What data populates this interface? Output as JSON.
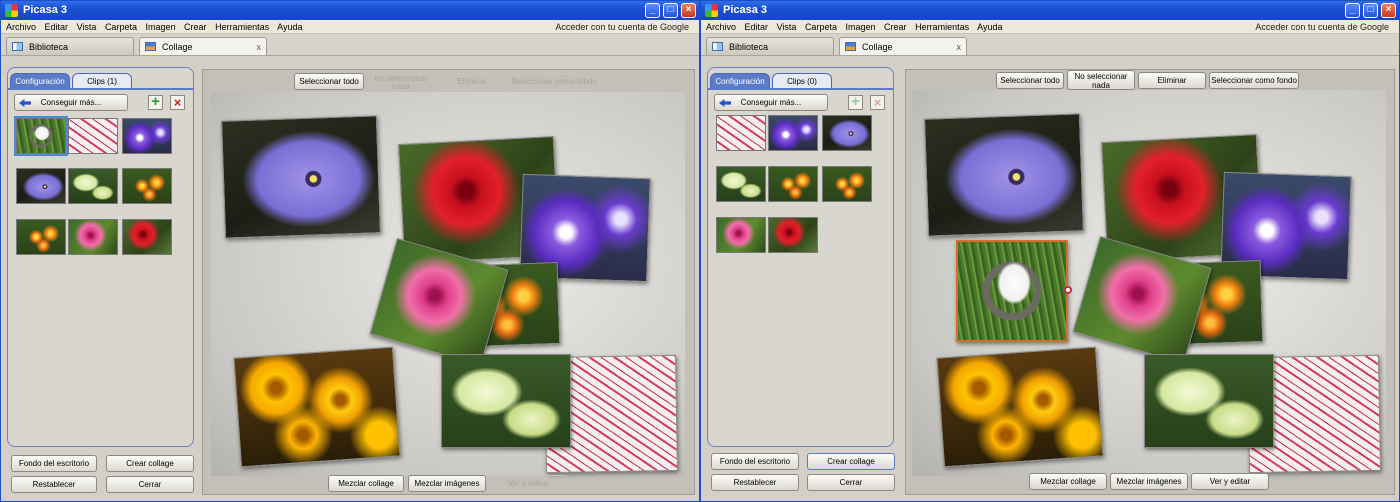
{
  "windows": [
    {
      "title": "Picasa 3",
      "menu": [
        "Archivo",
        "Editar",
        "Vista",
        "Carpeta",
        "Imagen",
        "Crear",
        "Herramientas",
        "Ayuda"
      ],
      "login": "Acceder con tu cuenta de Google",
      "tabs": {
        "library": "Biblioteca",
        "collage": "Collage"
      },
      "panel_tabs": {
        "config": "Configuración",
        "clips": "Clips (1)"
      },
      "get_more": "Conseguir más...",
      "toolbar": {
        "select_all": "Seleccionar todo",
        "deselect": "No seleccionar nada",
        "delete": "Eliminar",
        "set_bg": "Seleccionar como fondo"
      },
      "left_buttons": {
        "wallpaper": "Fondo del escritorio",
        "create": "Crear collage",
        "reset": "Restablecer",
        "close": "Cerrar"
      },
      "bottom_buttons": {
        "shuffle_collage": "Mezclar collage",
        "shuffle_images": "Mezclar imágenes",
        "view_edit": "Ver y editar"
      }
    },
    {
      "title": "Picasa 3",
      "menu": [
        "Archivo",
        "Editar",
        "Vista",
        "Carpeta",
        "Imagen",
        "Crear",
        "Herramientas",
        "Ayuda"
      ],
      "login": "Acceder con tu cuenta de Google",
      "tabs": {
        "library": "Biblioteca",
        "collage": "Collage"
      },
      "panel_tabs": {
        "config": "Configuración",
        "clips": "Clips (0)"
      },
      "get_more": "Conseguir más...",
      "toolbar": {
        "select_all": "Seleccionar todo",
        "deselect": "No seleccionar nada",
        "delete": "Eliminar",
        "set_bg": "Seleccionar como fondo"
      },
      "left_buttons": {
        "wallpaper": "Fondo del escritorio",
        "create": "Crear collage",
        "reset": "Restablecer",
        "close": "Cerrar"
      },
      "bottom_buttons": {
        "shuffle_collage": "Mezclar collage",
        "shuffle_images": "Mezclar imágenes",
        "view_edit": "Ver y editar"
      }
    }
  ],
  "tab_close_glyph": "x",
  "colors": {
    "title_bar": "#1c50d4",
    "selection_outline": "#d0702a",
    "thumb_selected": "#4a8ad8"
  }
}
